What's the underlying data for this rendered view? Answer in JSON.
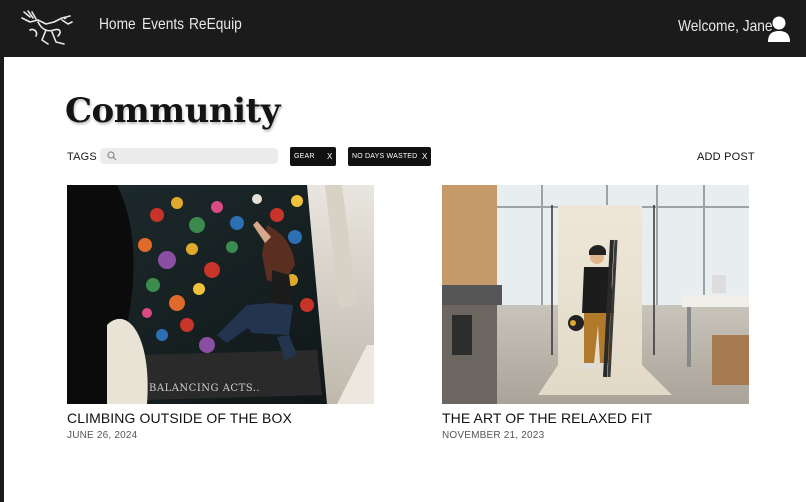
{
  "nav": {
    "logo_icon": "archaeopteryx-logo-icon",
    "links": [
      "Home",
      "Events",
      "ReEquip"
    ],
    "welcome": "Welcome, Jane",
    "user_icon": "user-icon"
  },
  "page": {
    "title": "Community",
    "tags_label": "TAGS",
    "search_placeholder": "",
    "search_icon": "search-icon",
    "chips": [
      {
        "label": "GEAR",
        "remove": "X"
      },
      {
        "label": "NO DAYS WASTED",
        "remove": "X"
      }
    ],
    "add_post": "ADD POST"
  },
  "posts": [
    {
      "title": "CLIMBING OUTSIDE OF THE BOX",
      "date": "JUNE 26, 2024",
      "image_text": "BALANCING ACTS.."
    },
    {
      "title": "THE ART OF THE RELAXED FIT",
      "date": "NOVEMBER 21, 2023"
    }
  ],
  "colors": {
    "nav_bg": "#1b1b1b",
    "nav_text": "#e8e8e8",
    "chip_bg": "#111111",
    "search_bg": "#ececec"
  }
}
